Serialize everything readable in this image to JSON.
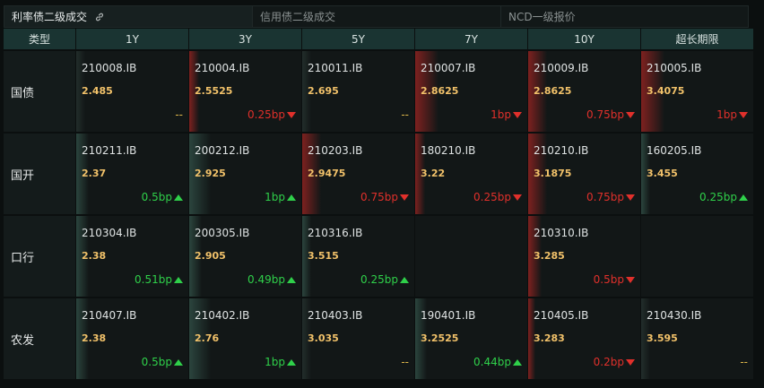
{
  "tabs": [
    {
      "label": "利率债二级成交",
      "active": true
    },
    {
      "label": "信用债二级成交",
      "active": false
    },
    {
      "label": "NCD一级报价",
      "active": false
    }
  ],
  "columns": [
    "类型",
    "1Y",
    "3Y",
    "5Y",
    "7Y",
    "10Y",
    "超长期限"
  ],
  "rows": [
    {
      "label": "国债",
      "cells": [
        {
          "code": "210008.IB",
          "yield": "2.485",
          "change": "--",
          "dir": "flat",
          "bar": "neutral",
          "bar_strength": 0.0
        },
        {
          "code": "210004.IB",
          "yield": "2.5525",
          "change": "0.25bp",
          "dir": "down",
          "bar": "red",
          "bar_strength": 0.3
        },
        {
          "code": "210011.IB",
          "yield": "2.695",
          "change": "--",
          "dir": "flat",
          "bar": "neutral",
          "bar_strength": 0.0
        },
        {
          "code": "210007.IB",
          "yield": "2.8625",
          "change": "1bp",
          "dir": "down",
          "bar": "red",
          "bar_strength": 1.0
        },
        {
          "code": "210009.IB",
          "yield": "2.8625",
          "change": "0.75bp",
          "dir": "down",
          "bar": "red",
          "bar_strength": 0.75
        },
        {
          "code": "210005.IB",
          "yield": "3.4075",
          "change": "1bp",
          "dir": "down",
          "bar": "red",
          "bar_strength": 1.0
        }
      ]
    },
    {
      "label": "国开",
      "cells": [
        {
          "code": "210211.IB",
          "yield": "2.37",
          "change": "0.5bp",
          "dir": "up",
          "bar": "green",
          "bar_strength": 0.5
        },
        {
          "code": "200212.IB",
          "yield": "2.925",
          "change": "1bp",
          "dir": "up",
          "bar": "green",
          "bar_strength": 1.0
        },
        {
          "code": "210203.IB",
          "yield": "2.9475",
          "change": "0.75bp",
          "dir": "down",
          "bar": "red",
          "bar_strength": 0.75
        },
        {
          "code": "180210.IB",
          "yield": "3.22",
          "change": "0.25bp",
          "dir": "down",
          "bar": "red",
          "bar_strength": 0.3
        },
        {
          "code": "210210.IB",
          "yield": "3.1875",
          "change": "0.75bp",
          "dir": "down",
          "bar": "red",
          "bar_strength": 0.75
        },
        {
          "code": "160205.IB",
          "yield": "3.455",
          "change": "0.25bp",
          "dir": "up",
          "bar": "green",
          "bar_strength": 0.3
        }
      ]
    },
    {
      "label": "口行",
      "cells": [
        {
          "code": "210304.IB",
          "yield": "2.38",
          "change": "0.51bp",
          "dir": "up",
          "bar": "green",
          "bar_strength": 0.5
        },
        {
          "code": "200305.IB",
          "yield": "2.905",
          "change": "0.49bp",
          "dir": "up",
          "bar": "green",
          "bar_strength": 0.5
        },
        {
          "code": "210316.IB",
          "yield": "3.515",
          "change": "0.25bp",
          "dir": "up",
          "bar": "green",
          "bar_strength": 0.3
        },
        {
          "code": "",
          "yield": "",
          "change": "",
          "dir": "none",
          "bar": "none",
          "bar_strength": 0.0
        },
        {
          "code": "210310.IB",
          "yield": "3.285",
          "change": "0.5bp",
          "dir": "down",
          "bar": "red",
          "bar_strength": 0.5
        },
        {
          "code": "",
          "yield": "",
          "change": "",
          "dir": "none",
          "bar": "none",
          "bar_strength": 0.0
        }
      ]
    },
    {
      "label": "农发",
      "cells": [
        {
          "code": "210407.IB",
          "yield": "2.38",
          "change": "0.5bp",
          "dir": "up",
          "bar": "green",
          "bar_strength": 0.5
        },
        {
          "code": "210402.IB",
          "yield": "2.76",
          "change": "1bp",
          "dir": "up",
          "bar": "green",
          "bar_strength": 1.0
        },
        {
          "code": "210403.IB",
          "yield": "3.035",
          "change": "--",
          "dir": "flat",
          "bar": "neutral",
          "bar_strength": 0.0
        },
        {
          "code": "190401.IB",
          "yield": "3.2525",
          "change": "0.44bp",
          "dir": "up",
          "bar": "green",
          "bar_strength": 0.45
        },
        {
          "code": "210405.IB",
          "yield": "3.283",
          "change": "0.2bp",
          "dir": "down",
          "bar": "red",
          "bar_strength": 0.2
        },
        {
          "code": "210430.IB",
          "yield": "3.595",
          "change": "--",
          "dir": "flat",
          "bar": "neutral",
          "bar_strength": 0.0
        }
      ]
    }
  ],
  "colors": {
    "up": "#2fd04a",
    "down": "#e0302b",
    "flat": "#e0b84a",
    "yield": "#f2c26a",
    "header_bg": "#1a3432",
    "bar_green": "#2e4a42",
    "bar_red": "#8a2220"
  }
}
